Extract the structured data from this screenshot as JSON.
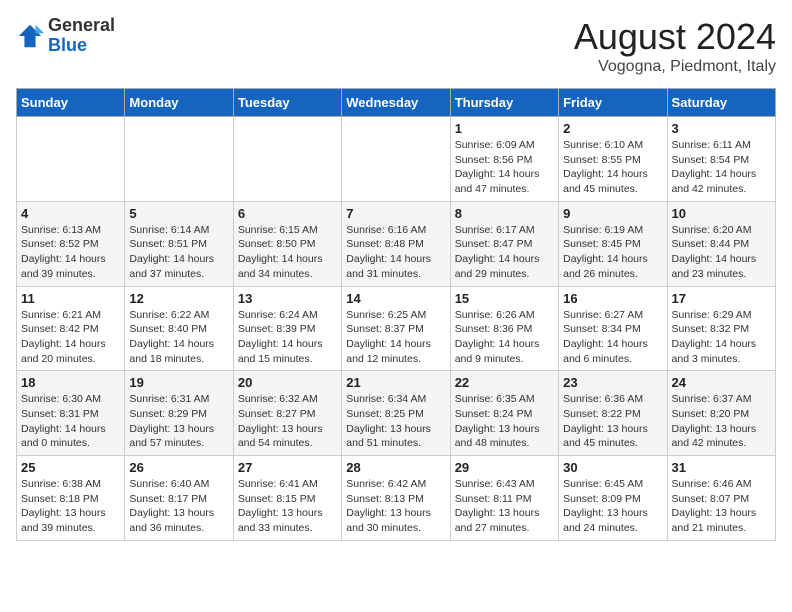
{
  "logo": {
    "general": "General",
    "blue": "Blue"
  },
  "header": {
    "month": "August 2024",
    "location": "Vogogna, Piedmont, Italy"
  },
  "weekdays": [
    "Sunday",
    "Monday",
    "Tuesday",
    "Wednesday",
    "Thursday",
    "Friday",
    "Saturday"
  ],
  "weeks": [
    [
      {
        "day": "",
        "info": ""
      },
      {
        "day": "",
        "info": ""
      },
      {
        "day": "",
        "info": ""
      },
      {
        "day": "",
        "info": ""
      },
      {
        "day": "1",
        "info": "Sunrise: 6:09 AM\nSunset: 8:56 PM\nDaylight: 14 hours\nand 47 minutes."
      },
      {
        "day": "2",
        "info": "Sunrise: 6:10 AM\nSunset: 8:55 PM\nDaylight: 14 hours\nand 45 minutes."
      },
      {
        "day": "3",
        "info": "Sunrise: 6:11 AM\nSunset: 8:54 PM\nDaylight: 14 hours\nand 42 minutes."
      }
    ],
    [
      {
        "day": "4",
        "info": "Sunrise: 6:13 AM\nSunset: 8:52 PM\nDaylight: 14 hours\nand 39 minutes."
      },
      {
        "day": "5",
        "info": "Sunrise: 6:14 AM\nSunset: 8:51 PM\nDaylight: 14 hours\nand 37 minutes."
      },
      {
        "day": "6",
        "info": "Sunrise: 6:15 AM\nSunset: 8:50 PM\nDaylight: 14 hours\nand 34 minutes."
      },
      {
        "day": "7",
        "info": "Sunrise: 6:16 AM\nSunset: 8:48 PM\nDaylight: 14 hours\nand 31 minutes."
      },
      {
        "day": "8",
        "info": "Sunrise: 6:17 AM\nSunset: 8:47 PM\nDaylight: 14 hours\nand 29 minutes."
      },
      {
        "day": "9",
        "info": "Sunrise: 6:19 AM\nSunset: 8:45 PM\nDaylight: 14 hours\nand 26 minutes."
      },
      {
        "day": "10",
        "info": "Sunrise: 6:20 AM\nSunset: 8:44 PM\nDaylight: 14 hours\nand 23 minutes."
      }
    ],
    [
      {
        "day": "11",
        "info": "Sunrise: 6:21 AM\nSunset: 8:42 PM\nDaylight: 14 hours\nand 20 minutes."
      },
      {
        "day": "12",
        "info": "Sunrise: 6:22 AM\nSunset: 8:40 PM\nDaylight: 14 hours\nand 18 minutes."
      },
      {
        "day": "13",
        "info": "Sunrise: 6:24 AM\nSunset: 8:39 PM\nDaylight: 14 hours\nand 15 minutes."
      },
      {
        "day": "14",
        "info": "Sunrise: 6:25 AM\nSunset: 8:37 PM\nDaylight: 14 hours\nand 12 minutes."
      },
      {
        "day": "15",
        "info": "Sunrise: 6:26 AM\nSunset: 8:36 PM\nDaylight: 14 hours\nand 9 minutes."
      },
      {
        "day": "16",
        "info": "Sunrise: 6:27 AM\nSunset: 8:34 PM\nDaylight: 14 hours\nand 6 minutes."
      },
      {
        "day": "17",
        "info": "Sunrise: 6:29 AM\nSunset: 8:32 PM\nDaylight: 14 hours\nand 3 minutes."
      }
    ],
    [
      {
        "day": "18",
        "info": "Sunrise: 6:30 AM\nSunset: 8:31 PM\nDaylight: 14 hours\nand 0 minutes."
      },
      {
        "day": "19",
        "info": "Sunrise: 6:31 AM\nSunset: 8:29 PM\nDaylight: 13 hours\nand 57 minutes."
      },
      {
        "day": "20",
        "info": "Sunrise: 6:32 AM\nSunset: 8:27 PM\nDaylight: 13 hours\nand 54 minutes."
      },
      {
        "day": "21",
        "info": "Sunrise: 6:34 AM\nSunset: 8:25 PM\nDaylight: 13 hours\nand 51 minutes."
      },
      {
        "day": "22",
        "info": "Sunrise: 6:35 AM\nSunset: 8:24 PM\nDaylight: 13 hours\nand 48 minutes."
      },
      {
        "day": "23",
        "info": "Sunrise: 6:36 AM\nSunset: 8:22 PM\nDaylight: 13 hours\nand 45 minutes."
      },
      {
        "day": "24",
        "info": "Sunrise: 6:37 AM\nSunset: 8:20 PM\nDaylight: 13 hours\nand 42 minutes."
      }
    ],
    [
      {
        "day": "25",
        "info": "Sunrise: 6:38 AM\nSunset: 8:18 PM\nDaylight: 13 hours\nand 39 minutes."
      },
      {
        "day": "26",
        "info": "Sunrise: 6:40 AM\nSunset: 8:17 PM\nDaylight: 13 hours\nand 36 minutes."
      },
      {
        "day": "27",
        "info": "Sunrise: 6:41 AM\nSunset: 8:15 PM\nDaylight: 13 hours\nand 33 minutes."
      },
      {
        "day": "28",
        "info": "Sunrise: 6:42 AM\nSunset: 8:13 PM\nDaylight: 13 hours\nand 30 minutes."
      },
      {
        "day": "29",
        "info": "Sunrise: 6:43 AM\nSunset: 8:11 PM\nDaylight: 13 hours\nand 27 minutes."
      },
      {
        "day": "30",
        "info": "Sunrise: 6:45 AM\nSunset: 8:09 PM\nDaylight: 13 hours\nand 24 minutes."
      },
      {
        "day": "31",
        "info": "Sunrise: 6:46 AM\nSunset: 8:07 PM\nDaylight: 13 hours\nand 21 minutes."
      }
    ]
  ]
}
